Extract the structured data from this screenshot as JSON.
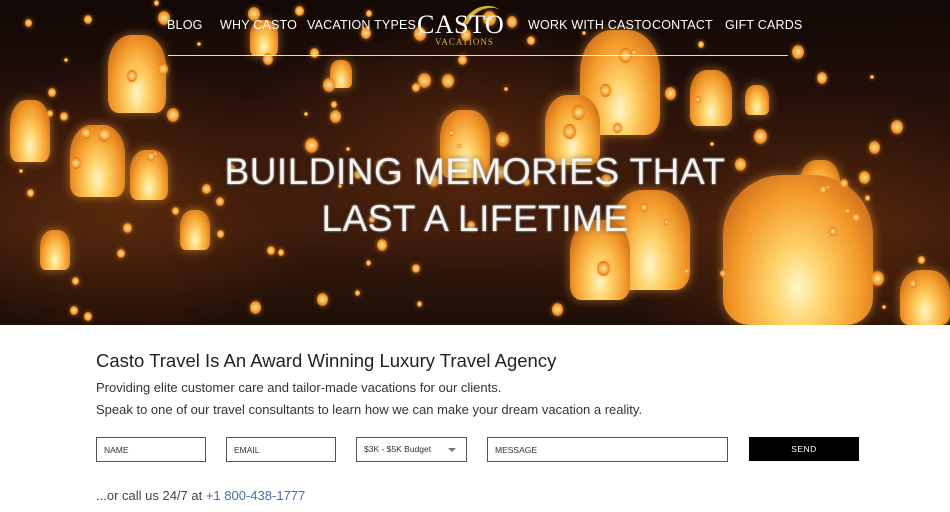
{
  "nav": {
    "left_items": [
      "BLOG",
      "WHY CASTO",
      "VACATION TYPES"
    ],
    "right_items": [
      "WORK WITH CASTO",
      "CONTACT",
      "GIFT CARDS"
    ]
  },
  "logo": {
    "name": "CASTO",
    "sub": "VACATIONS",
    "gold": "#d4af37"
  },
  "hero": {
    "line1": "BUILDING MEMORIES THAT",
    "line2": "LAST A LIFETIME"
  },
  "intro": {
    "headline": "Casto Travel Is An Award Winning Luxury Travel Agency",
    "para1": "Providing elite customer care and tailor-made vacations for our clients.",
    "para2": "Speak to one of our travel consultants to learn how we can make your dream vacation a reality."
  },
  "form": {
    "name_placeholder": "NAME",
    "email_placeholder": "EMAIL",
    "budget_selected": "$3K - $5K Budget",
    "message_placeholder": "MESSAGE",
    "send_label": "SEND"
  },
  "call": {
    "prefix": "...or call us 24/7 at ",
    "phone": "+1 800-438-1777",
    "link_color": "#4a6fa5"
  }
}
